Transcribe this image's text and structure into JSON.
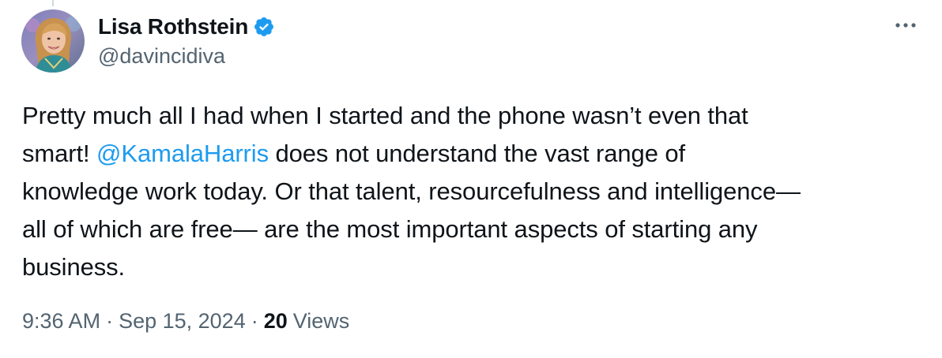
{
  "author": {
    "display_name": "Lisa Rothstein",
    "handle": "@davincidiva",
    "verified": true,
    "verified_color": "#1d9bf0"
  },
  "tweet": {
    "line1": "Pretty much all I had when I started and the phone wasn’t even that",
    "line2_prefix": "smart!  ",
    "mention": "@KamalaHarris",
    "line2_suffix": " does not understand the vast range of",
    "line3": "knowledge work today. Or that talent, resourcefulness and intelligence—",
    "line4": "all of which are free— are the most important aspects of starting any",
    "line5": "business."
  },
  "meta": {
    "time": "9:36 AM",
    "separator": "·",
    "date": "Sep 15, 2024",
    "views_count": "20",
    "views_label": "Views"
  },
  "icons": {
    "more": "more-horizontal-icon",
    "verified": "verified-badge-icon"
  },
  "colors": {
    "link": "#1d9bf0",
    "secondary_text": "#536471",
    "primary_text": "#0f1419"
  }
}
